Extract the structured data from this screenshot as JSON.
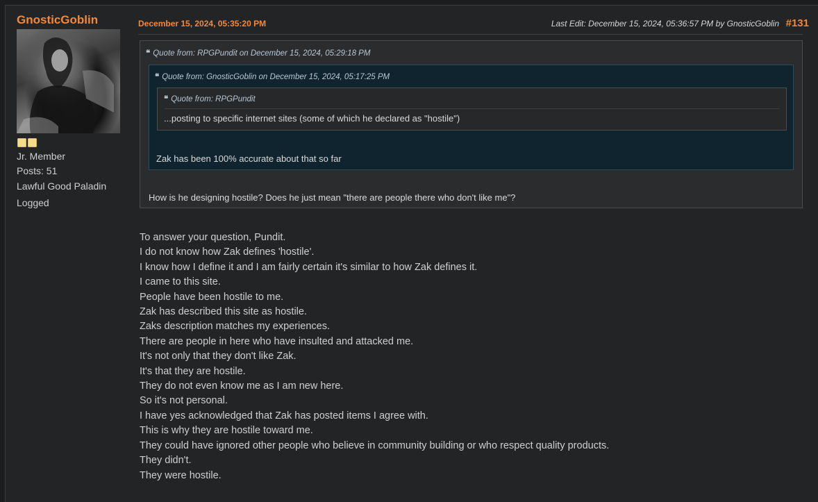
{
  "poster": {
    "name": "GnosticGoblin",
    "rank": "Jr. Member",
    "posts": "Posts: 51",
    "alignment": "Lawful Good Paladin",
    "status": "Logged",
    "stars": 2
  },
  "post": {
    "date": "December 15, 2024, 05:35:20 PM",
    "last_edit": "Last Edit: December 15, 2024, 05:36:57 PM by GnosticGoblin",
    "number": "#131"
  },
  "quotes": {
    "outer_header": "Quote from: RPGPundit on December 15, 2024, 05:29:18 PM",
    "mid_header": "Quote from: GnosticGoblin on December 15, 2024, 05:17:25 PM",
    "inner_header": "Quote from: RPGPundit",
    "inner_text": "...posting to specific internet sites (some of which he declared as \"hostile\")",
    "mid_text": "Zak has been 100% accurate about that so far",
    "outer_text": "How is he designing hostile? Does he just mean \"there are people there who don't like me\"?",
    "quote_mark": "❝"
  },
  "body": [
    "To answer your question, Pundit.",
    "I do not know how Zak defines 'hostile'.",
    "I know how I define it and I am fairly certain it's similar to how Zak defines it.",
    "I came to this site.",
    "People have been hostile to me.",
    "Zak has described this site as hostile.",
    "Zaks description matches my experiences.",
    "There are people in here who have insulted and attacked me.",
    "It's not only that they don't like Zak.",
    "It's that they are hostile.",
    "They do not even know me as I am new here.",
    "So it's not personal.",
    "I have yes acknowledged that Zak has posted items I agree with.",
    "This is why they are hostile toward me.",
    "They could have ignored other people who believe in community building or who respect quality products.",
    "They didn't.",
    "They were hostile."
  ],
  "colors": {
    "accent": "#f08a3a",
    "quote_bg": "#10242f",
    "page_bg": "#1b1d1f"
  }
}
